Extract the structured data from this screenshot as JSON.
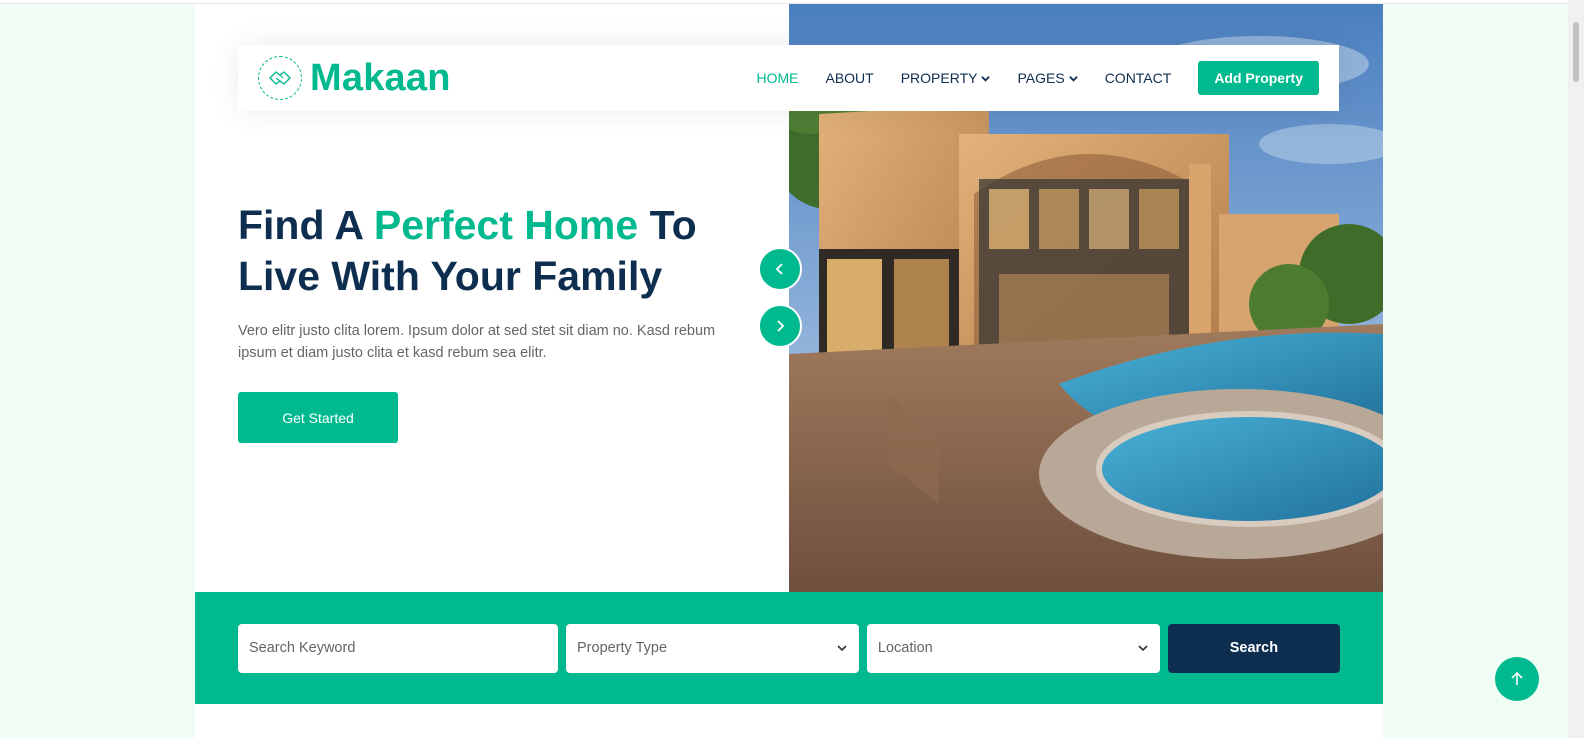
{
  "brand": {
    "name": "Makaan",
    "icon": "handshake-house-icon"
  },
  "nav": {
    "items": [
      {
        "label": "HOME",
        "active": true
      },
      {
        "label": "ABOUT"
      },
      {
        "label": "PROPERTY",
        "dropdown": true
      },
      {
        "label": "PAGES",
        "dropdown": true
      },
      {
        "label": "CONTACT"
      }
    ],
    "add_property_label": "Add Property"
  },
  "hero": {
    "title_part1": "Find A ",
    "title_accent": "Perfect Home",
    "title_part2": " To Live With Your Family",
    "description": "Vero elitr justo clita lorem. Ipsum dolor at sed stet sit diam no. Kasd rebum ipsum et diam justo clita et kasd rebum sea elitr.",
    "cta_label": "Get Started",
    "image": "luxury-house-pool-photo"
  },
  "search": {
    "keyword_placeholder": "Search Keyword",
    "property_type_value": "Property Type",
    "location_value": "Location",
    "button_label": "Search"
  },
  "colors": {
    "primary": "#00B98E",
    "dark": "#0E2E50",
    "background": "#EFFDF5"
  }
}
